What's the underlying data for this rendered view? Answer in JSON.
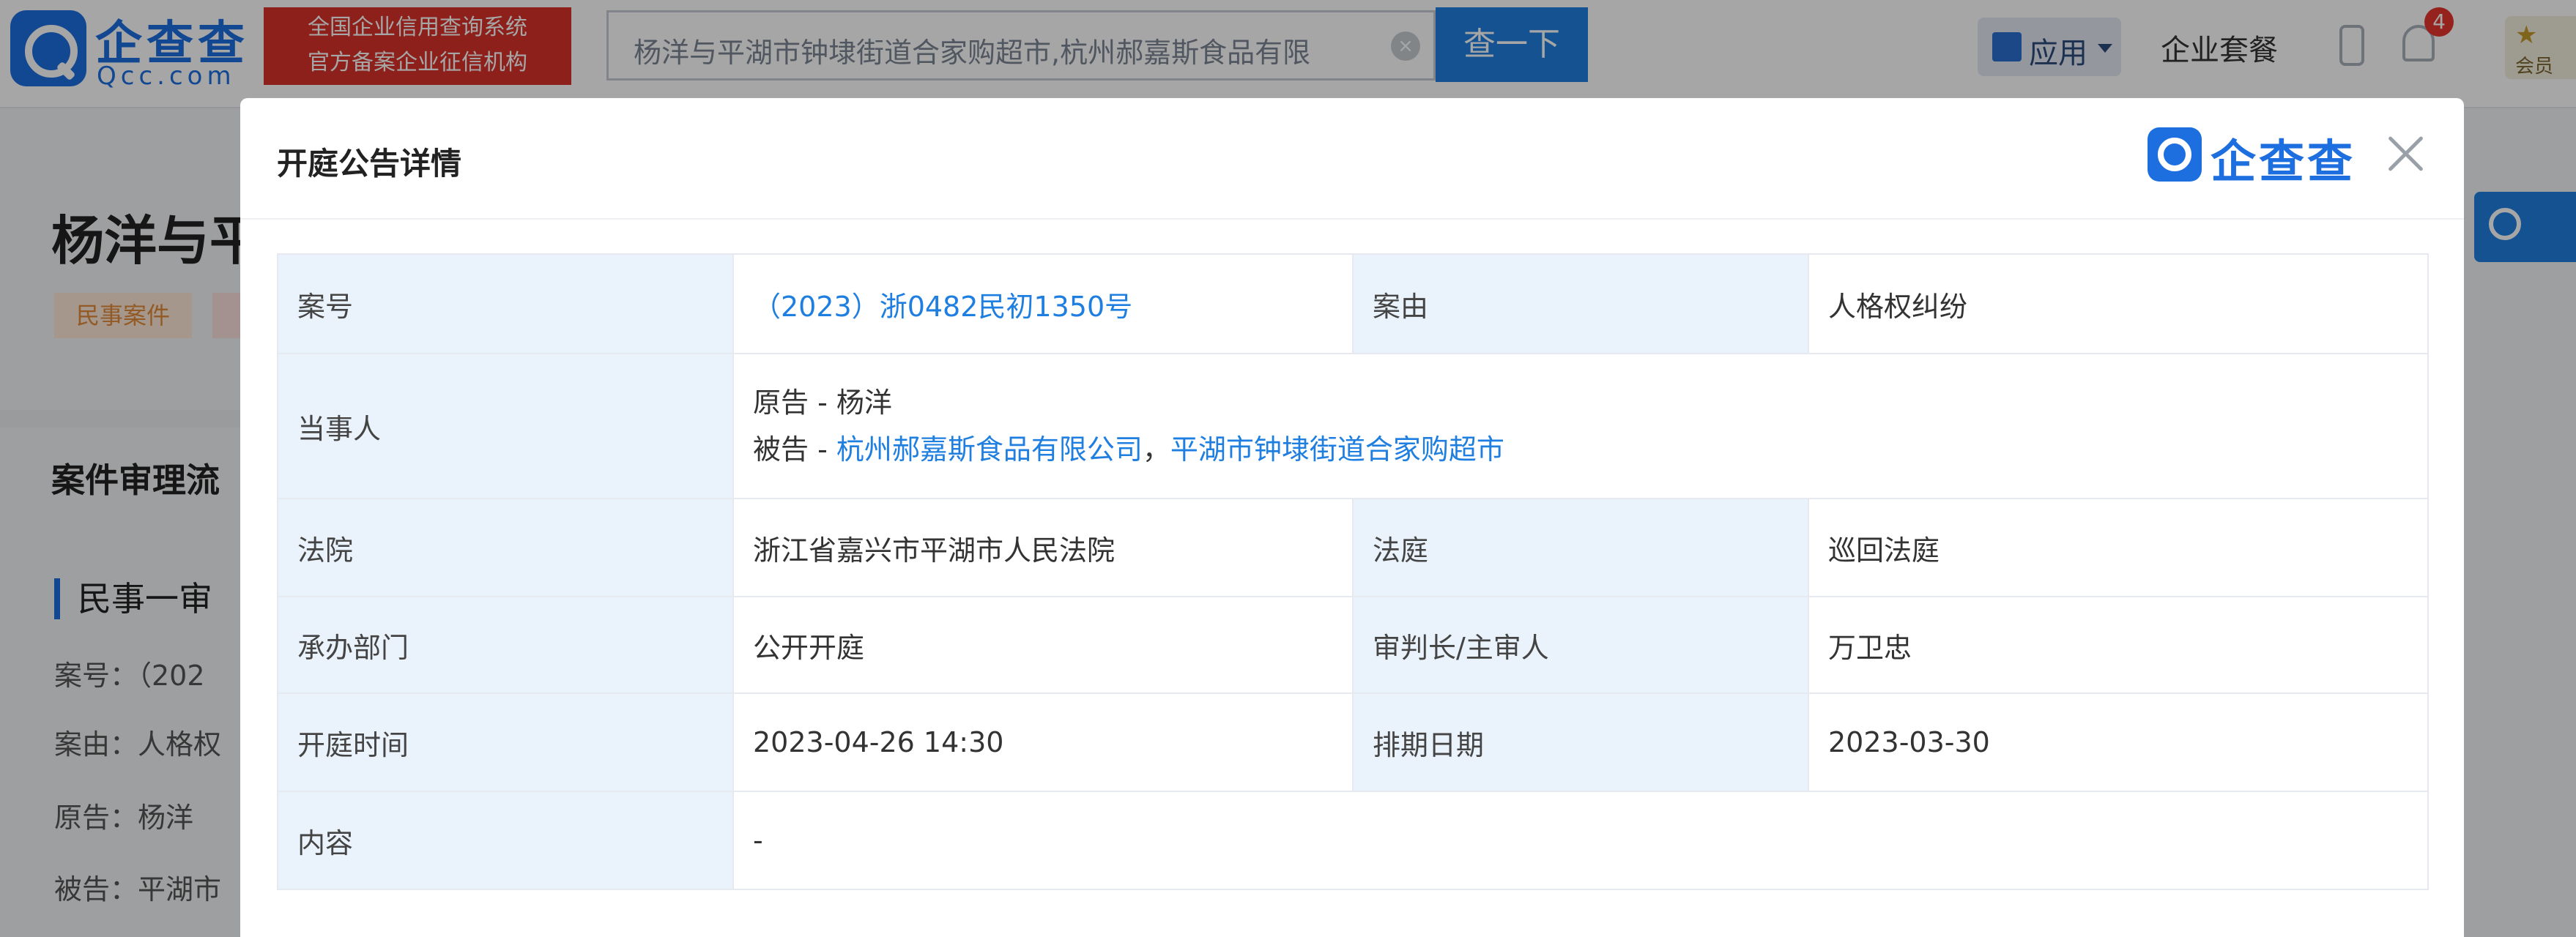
{
  "header": {
    "logo": {
      "name": "企查查",
      "sub": "Qcc.com"
    },
    "badge_lines": [
      "全国企业信用查询系统",
      "官方备案企业征信机构"
    ],
    "search": {
      "value": "杨洋与平湖市钟埭街道合家购超市,杭州郝嘉斯食品有限"
    },
    "search_button": "查一下",
    "app_menu": "应用",
    "enterprise_link": "企业套餐",
    "notification_count": "4",
    "vip_label": "会员"
  },
  "background": {
    "page_title": "杨洋与平",
    "tag": "民事案件",
    "section_title": "案件审理流",
    "sub_title": "民事一审",
    "lines": [
      "案号：（202",
      "案由：人格权",
      "原告：杨洋",
      "被告：平湖市"
    ]
  },
  "modal": {
    "title": "开庭公告详情",
    "logo_text": "企查查",
    "rows": {
      "case_no_label": "案号",
      "case_no_value": "（2023）浙0482民初1350号",
      "cause_label": "案由",
      "cause_value": "人格权纠纷",
      "party_label": "当事人",
      "plaintiff_prefix": "原告 - ",
      "plaintiff": "杨洋",
      "defendant_prefix": "被告 - ",
      "defendant_1": "杭州郝嘉斯食品有限公司",
      "separator": "，",
      "defendant_2": "平湖市钟埭街道合家购超市",
      "court_label": "法院",
      "court_value": "浙江省嘉兴市平湖市人民法院",
      "courtroom_label": "法庭",
      "courtroom_value": "巡回法庭",
      "dept_label": "承办部门",
      "dept_value": "公开开庭",
      "judge_label": "审判长/主审人",
      "judge_value": "万卫忠",
      "hearing_time_label": "开庭时间",
      "hearing_time_value": "2023-04-26 14:30",
      "schedule_label": "排期日期",
      "schedule_value": "2023-03-30",
      "content_label": "内容",
      "content_value": "-"
    }
  }
}
